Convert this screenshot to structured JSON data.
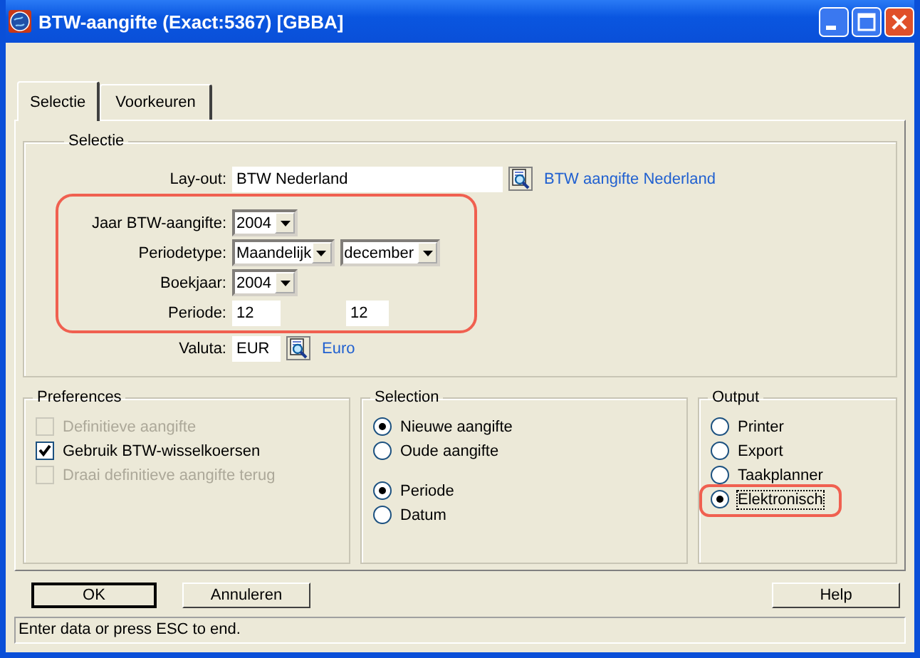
{
  "window": {
    "title": "BTW-aangifte (Exact:5367) [GBBA]"
  },
  "tabs": [
    {
      "label": "Selectie",
      "selected": true
    },
    {
      "label": "Voorkeuren",
      "selected": false
    }
  ],
  "selectie": {
    "title": "Selectie",
    "rows": [
      {
        "label": "Lay-out:",
        "highlighted": false,
        "controls": [
          {
            "kind": "text",
            "value": "BTW Nederland"
          },
          {
            "kind": "lookup"
          },
          {
            "kind": "link",
            "value": "BTW aangifte Nederland"
          }
        ]
      },
      {
        "label": "Jaar BTW-aangifte:",
        "highlighted": true,
        "controls": [
          {
            "kind": "dropdown",
            "value": "2004"
          }
        ]
      },
      {
        "label": "Periodetype:",
        "highlighted": true,
        "controls": [
          {
            "kind": "dropdown",
            "value": "Maandelijk"
          },
          {
            "kind": "dropdown",
            "value": "december"
          }
        ]
      },
      {
        "label": "Boekjaar:",
        "highlighted": true,
        "controls": [
          {
            "kind": "dropdown",
            "value": "2004"
          }
        ]
      },
      {
        "label": "Periode:",
        "highlighted": true,
        "controls": [
          {
            "kind": "text",
            "value": "12"
          },
          {
            "kind": "gap"
          },
          {
            "kind": "text",
            "value": "12"
          }
        ]
      },
      {
        "label": "Valuta:",
        "highlighted": false,
        "controls": [
          {
            "kind": "text",
            "value": "EUR"
          },
          {
            "kind": "lookup"
          },
          {
            "kind": "link",
            "value": "Euro"
          }
        ]
      }
    ]
  },
  "preferences": {
    "title": "Preferences",
    "items": [
      {
        "label": "Definitieve aangifte",
        "checked": false,
        "disabled": true
      },
      {
        "label": "Gebruik BTW-wisselkoersen",
        "checked": true,
        "disabled": false
      },
      {
        "label": "Draai definitieve aangifte terug",
        "checked": false,
        "disabled": true
      }
    ]
  },
  "selection": {
    "title": "Selection",
    "groups": [
      [
        {
          "label": "Nieuwe aangifte",
          "selected": true
        },
        {
          "label": "Oude aangifte",
          "selected": false
        }
      ],
      [
        {
          "label": "Periode",
          "selected": true
        },
        {
          "label": "Datum",
          "selected": false
        }
      ]
    ]
  },
  "output": {
    "title": "Output",
    "options": [
      {
        "label": "Printer",
        "selected": false,
        "highlighted": false
      },
      {
        "label": "Export",
        "selected": false,
        "highlighted": false
      },
      {
        "label": "Taakplanner",
        "selected": false,
        "highlighted": false
      },
      {
        "label": "Elektronisch",
        "selected": true,
        "highlighted": true
      }
    ]
  },
  "buttons": [
    {
      "label": "OK",
      "default": true
    },
    {
      "label": "Annuleren",
      "default": false
    },
    {
      "label": "Help",
      "default": false
    }
  ],
  "status_bar": "Enter data or press ESC to end."
}
